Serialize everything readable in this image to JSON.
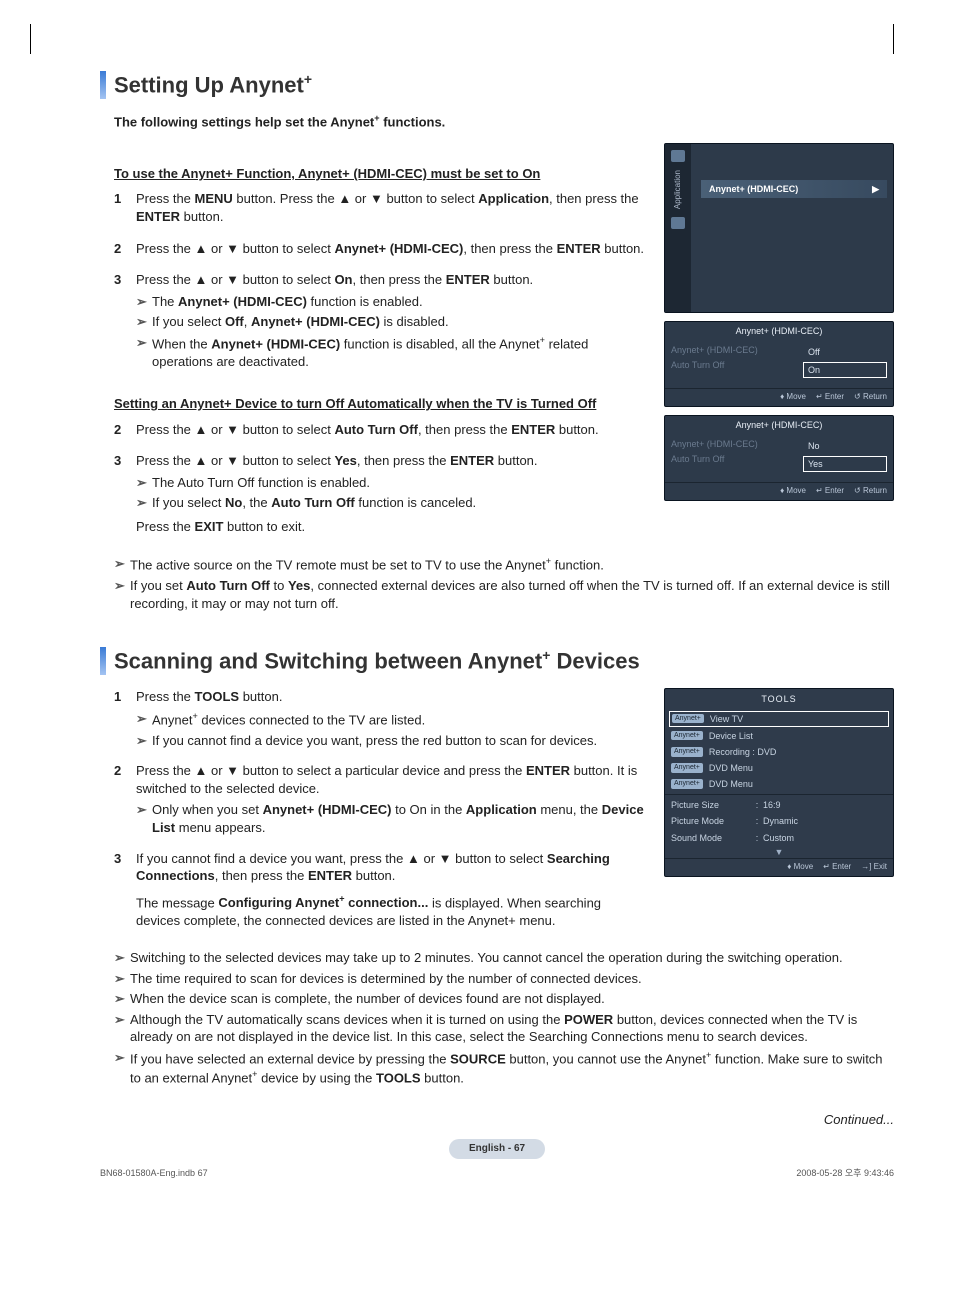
{
  "headings": {
    "h1a": "Setting Up Anynet",
    "h1a_plus": "+",
    "intro_pre": "The following settings help set the Anynet",
    "intro_plus": "+",
    "intro_post": " functions.",
    "sub1": "To use the Anynet+ Function, Anynet+ (HDMI-CEC) must be set to On",
    "sub2": "Setting an Anynet+ Device to turn Off Automatically when the TV is Turned Off",
    "h1b_pre": "Scanning and Switching between Anynet",
    "h1b_plus": "+",
    "h1b_post": " Devices"
  },
  "step1": {
    "n": "1",
    "body_html": "Press the <b>MENU</b> button. Press the ▲ or ▼ button to select <b>Application</b>, then press the <b>ENTER</b> button."
  },
  "step2": {
    "n": "2",
    "body_html": "Press the ▲ or ▼ button to select <b>Anynet+ (HDMI-CEC)</b>, then press the <b>ENTER</b> button."
  },
  "step3": {
    "n": "3",
    "body_html": "Press the ▲ or ▼ button to select <b>On</b>, then press the <b>ENTER</b> button.",
    "sub1_html": "The <b>Anynet+ (HDMI-CEC)</b> function is enabled.",
    "sub2_html": "If you select <b>Off</b>, <b>Anynet+ (HDMI-CEC)</b> is disabled.",
    "sub3_html": "When the <b>Anynet+ (HDMI-CEC)</b> function is disabled, all the Anynet<sup>+</sup> related operations are deactivated."
  },
  "stepB2": {
    "n": "2",
    "body_html": "Press the ▲ or ▼ button to select <b>Auto Turn Off</b>, then press the <b>ENTER</b> button."
  },
  "stepB3": {
    "n": "3",
    "body_html": "Press the ▲ or ▼ button to select <b>Yes</b>, then press the <b>ENTER</b> button.",
    "sub1_html": "The Auto Turn Off function is enabled.",
    "sub2_html": "If you select <b>No</b>, the <b>Auto Turn Off</b> function is canceled.",
    "exit_html": "Press the <b>EXIT</b> button to exit."
  },
  "notesA": {
    "n1_html": "The active source on the TV remote must be set to TV to use the Anynet<sup>+</sup> function.",
    "n2_html": "If you set <b>Auto Turn Off</b> to <b>Yes</b>, connected external devices are also turned off when the TV is turned off. If an external device is still recording, it may or may not turn off."
  },
  "scan": {
    "s1": {
      "n": "1",
      "body_html": "Press the <b>TOOLS</b> button.",
      "a1_html": "Anynet<sup>+</sup> devices connected to the TV are listed.",
      "a2_html": "If you cannot find a device you want, press the red button to scan for devices."
    },
    "s2": {
      "n": "2",
      "body_html": "Press the ▲ or ▼ button to select a particular device and press the <b>ENTER</b> button. It is switched to the selected device.",
      "a1_html": "Only when you set <b>Anynet+ (HDMI-CEC)</b> to On in the <b>Application</b> menu, the <b>Device List</b> menu appears."
    },
    "s3": {
      "n": "3",
      "body_html": "If you cannot find a device you want, press the ▲ or ▼ button to select <b>Searching Connections</b>, then press the <b>ENTER</b> button.",
      "msg_html": "The message <b>Configuring Anynet<sup>+</sup> connection...</b> is displayed. When searching devices complete, the connected devices are listed in the Anynet+ menu."
    }
  },
  "notesB": {
    "n1": "Switching to the selected devices may take up to 2 minutes. You cannot cancel the operation during the switching operation.",
    "n2": "The time required to scan for devices is determined by the number of connected devices.",
    "n3": "When the device scan is complete, the number of devices found are not displayed.",
    "n4_html": "Although the TV automatically scans devices when it is turned on using the <b>POWER</b> button, devices connected when the TV is already on are not displayed in the device list. In this case, select the Searching Connections menu to search devices.",
    "n5_html": "If you have selected an external device by pressing the <b>SOURCE</b> button, you cannot use the Anynet<sup>+</sup> function. Make sure to switch to an external Anynet<sup>+</sup> device by using the <b>TOOLS</b> button."
  },
  "osd": {
    "big_sidebar": "Application",
    "big_row": "Anynet+ (HDMI-CEC)",
    "big_arrow": "▶",
    "m1_title": "Anynet+ (HDMI-CEC)",
    "m1_l1": "Anynet+ (HDMI-CEC)",
    "m1_l2": "Auto Turn Off",
    "m1_o1": "Off",
    "m1_o2": "On",
    "m2_title": "Anynet+ (HDMI-CEC)",
    "m2_l1": "Anynet+ (HDMI-CEC)",
    "m2_l2": "Auto Turn Off",
    "m2_o1": "No",
    "m2_o2": "Yes",
    "foot_move": "Move",
    "foot_enter": "Enter",
    "foot_return": "Return",
    "foot_exit": "Exit",
    "tools_title": "TOOLS",
    "tools_r1": "View TV",
    "tools_r2": "Device List",
    "tools_r3": "Recording : DVD",
    "tools_r4": "DVD Menu",
    "tools_r5": "DVD Menu",
    "tools_k1": "Picture Size",
    "tools_v1": "16:9",
    "tools_k2": "Picture Mode",
    "tools_v2": "Dynamic",
    "tools_k3": "Sound Mode",
    "tools_v3": "Custom",
    "tools_down": "▼"
  },
  "continued": "Continued...",
  "pager": "English - 67",
  "footer_left": "BN68-01580A-Eng.indb   67",
  "footer_right": "2008-05-28   오후 9:43:46"
}
